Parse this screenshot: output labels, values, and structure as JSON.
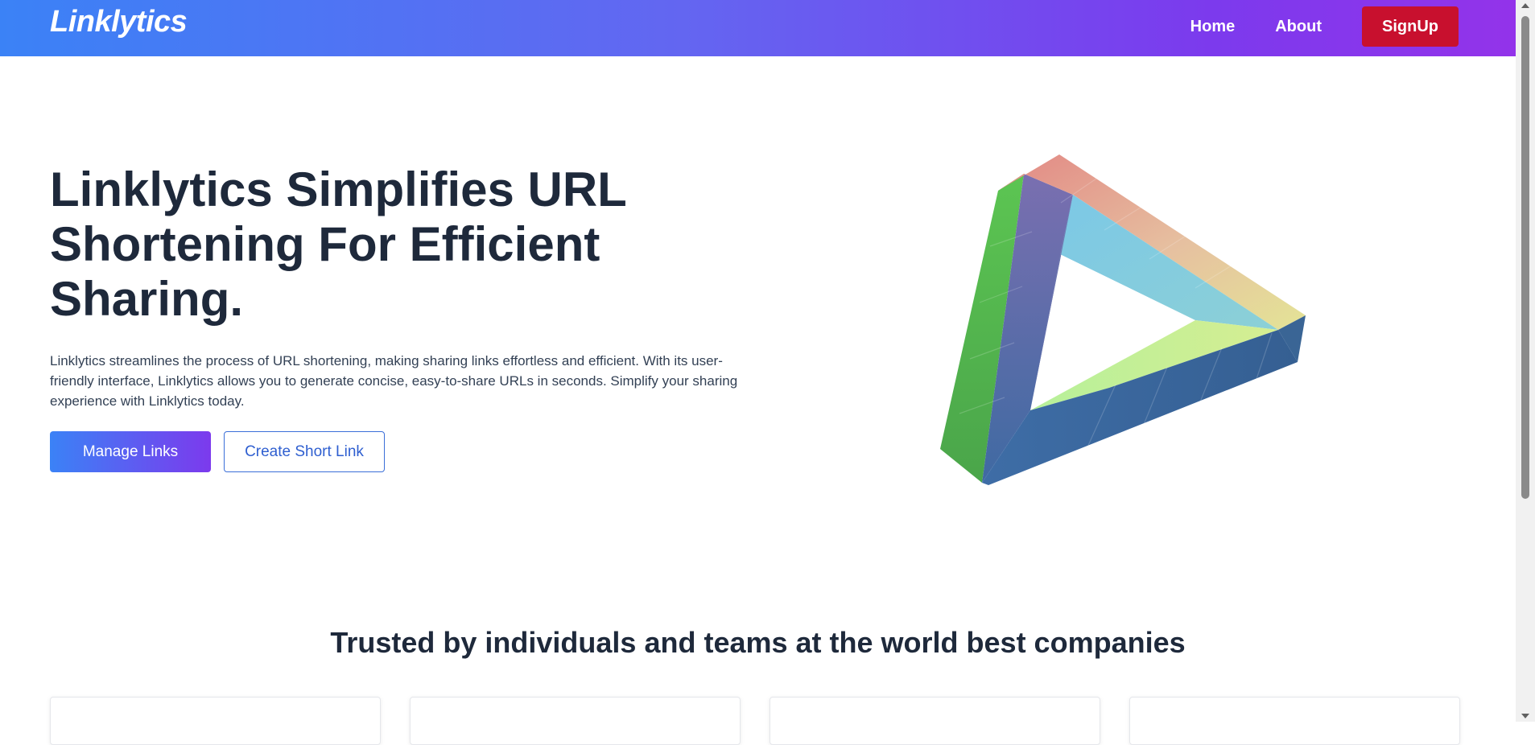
{
  "header": {
    "logo": "Linklytics",
    "nav": [
      {
        "label": "Home"
      },
      {
        "label": "About"
      }
    ],
    "signup_label": "SignUp"
  },
  "hero": {
    "title": "Linklytics Simplifies URL Shortening For Efficient Sharing.",
    "description": "Linklytics streamlines the process of URL shortening, making sharing links effortless and efficient. With its user-friendly interface, Linklytics allows you to generate concise, easy-to-share URLs in seconds. Simplify your sharing experience with Linklytics today.",
    "primary_button": "Manage Links",
    "secondary_button": "Create Short Link",
    "illustration": "impossible-triangle-icon"
  },
  "trusted": {
    "title": "Trusted by individuals and teams at the world best companies",
    "cards": [
      {},
      {},
      {},
      {}
    ]
  },
  "colors": {
    "header_gradient_start": "#3b82f6",
    "header_gradient_end": "#9333ea",
    "signup": "#c8102e",
    "heading": "#1e293b",
    "outline_button": "#2f5fd0"
  }
}
